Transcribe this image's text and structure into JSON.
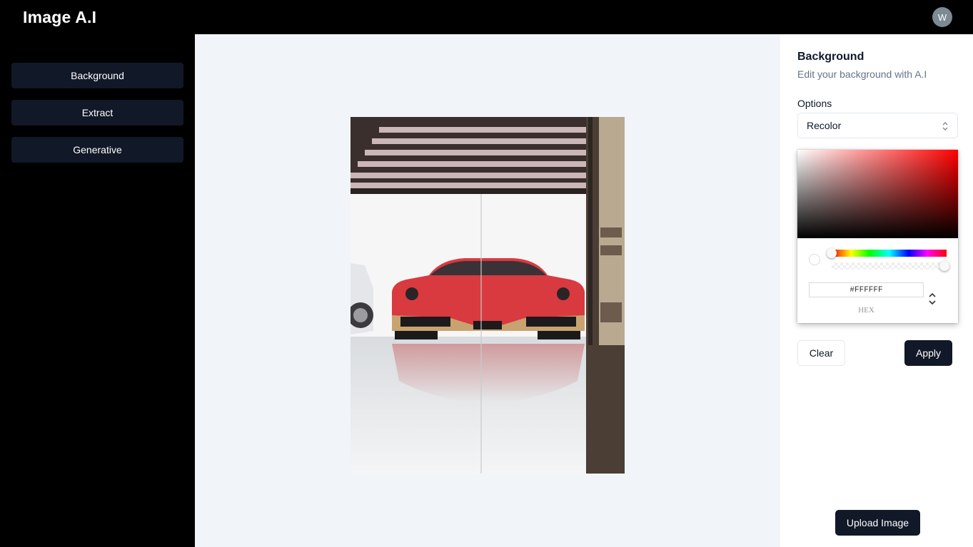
{
  "app": {
    "title": "Image A.I",
    "avatar_initial": "W"
  },
  "sidebar": {
    "items": [
      {
        "label": "Background"
      },
      {
        "label": "Extract"
      },
      {
        "label": "Generative"
      }
    ]
  },
  "panel": {
    "title": "Background",
    "subtitle": "Edit your background with A.I",
    "options_label": "Options",
    "selected_option": "Recolor",
    "color_picker": {
      "hex_value": "#FFFFFF",
      "mode_label": "HEX",
      "hue_color": "#FF0000"
    },
    "clear_label": "Clear",
    "apply_label": "Apply",
    "upload_label": "Upload Image"
  },
  "colors": {
    "brand_dark": "#111827",
    "canvas_bg": "#F1F5F9",
    "muted_text": "#64748B"
  }
}
